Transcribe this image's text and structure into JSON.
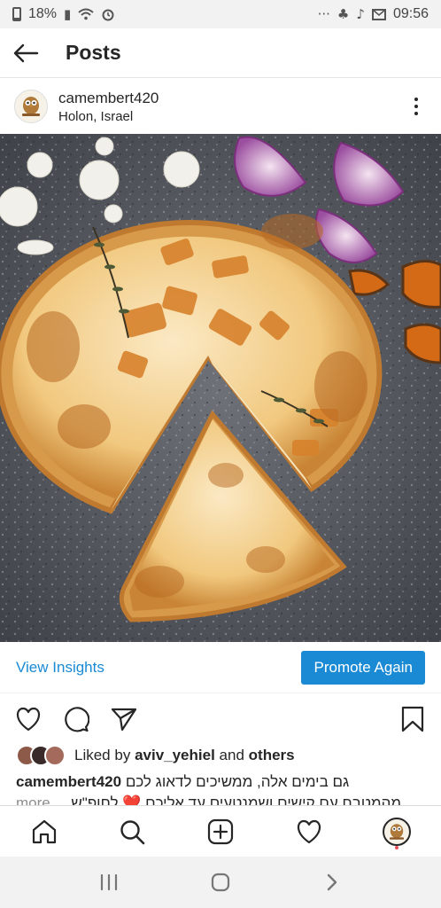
{
  "status_bar": {
    "battery": "18%",
    "time": "09:56",
    "overflow": "···"
  },
  "header": {
    "title": "Posts",
    "back_icon": "arrow-left-icon"
  },
  "post": {
    "username": "camembert420",
    "location": "Holon, Israel",
    "photo_description_icon": "quiche-photo"
  },
  "insights": {
    "view_label": "View Insights",
    "promote_label": "Promote Again"
  },
  "likes": {
    "prefix": "Liked by",
    "user": "aviv_yehiel",
    "and": "and",
    "others": "others"
  },
  "caption": {
    "username": "camembert420",
    "line1": "גם בימים אלה, ממשיכים לדאוג לכם",
    "line2": "מהמטבח עם קישים ושמנטעים עד אליכם ❤️ לחופ\"ש",
    "more": "... more"
  },
  "colors": {
    "accent": "#1a8ad4",
    "text": "#262626",
    "notif": "#ed4956"
  }
}
